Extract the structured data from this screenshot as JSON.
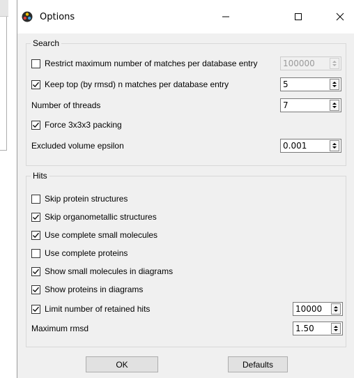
{
  "dialog": {
    "title": "Options",
    "window_controls": {
      "minimize": "—",
      "maximize": "☐",
      "close": "✕"
    }
  },
  "search": {
    "title": "Search",
    "restrict_max_matches": {
      "label": "Restrict maximum number of matches per database entry",
      "checked": false,
      "value": "100000"
    },
    "keep_top": {
      "label": "Keep top (by rmsd) n matches per database entry",
      "checked": true,
      "value": "5"
    },
    "threads": {
      "label": "Number of threads",
      "value": "7"
    },
    "force_packing": {
      "label": "Force 3x3x3 packing",
      "checked": true
    },
    "excluded_volume": {
      "label": "Excluded volume epsilon",
      "value": "0.001"
    }
  },
  "hits": {
    "title": "Hits",
    "skip_protein": {
      "label": "Skip protein structures",
      "checked": false
    },
    "skip_organometallic": {
      "label": "Skip organometallic structures",
      "checked": true
    },
    "use_small_molecules": {
      "label": "Use complete small molecules",
      "checked": true
    },
    "use_proteins": {
      "label": "Use complete proteins",
      "checked": false
    },
    "show_small_molecules": {
      "label": "Show small molecules in diagrams",
      "checked": true
    },
    "show_proteins": {
      "label": "Show proteins in diagrams",
      "checked": true
    },
    "limit_hits": {
      "label": "Limit number of retained hits",
      "checked": true,
      "value": "10000"
    },
    "max_rmsd": {
      "label": "Maximum rmsd",
      "value": "1.50"
    }
  },
  "buttons": {
    "ok": "OK",
    "defaults": "Defaults"
  }
}
